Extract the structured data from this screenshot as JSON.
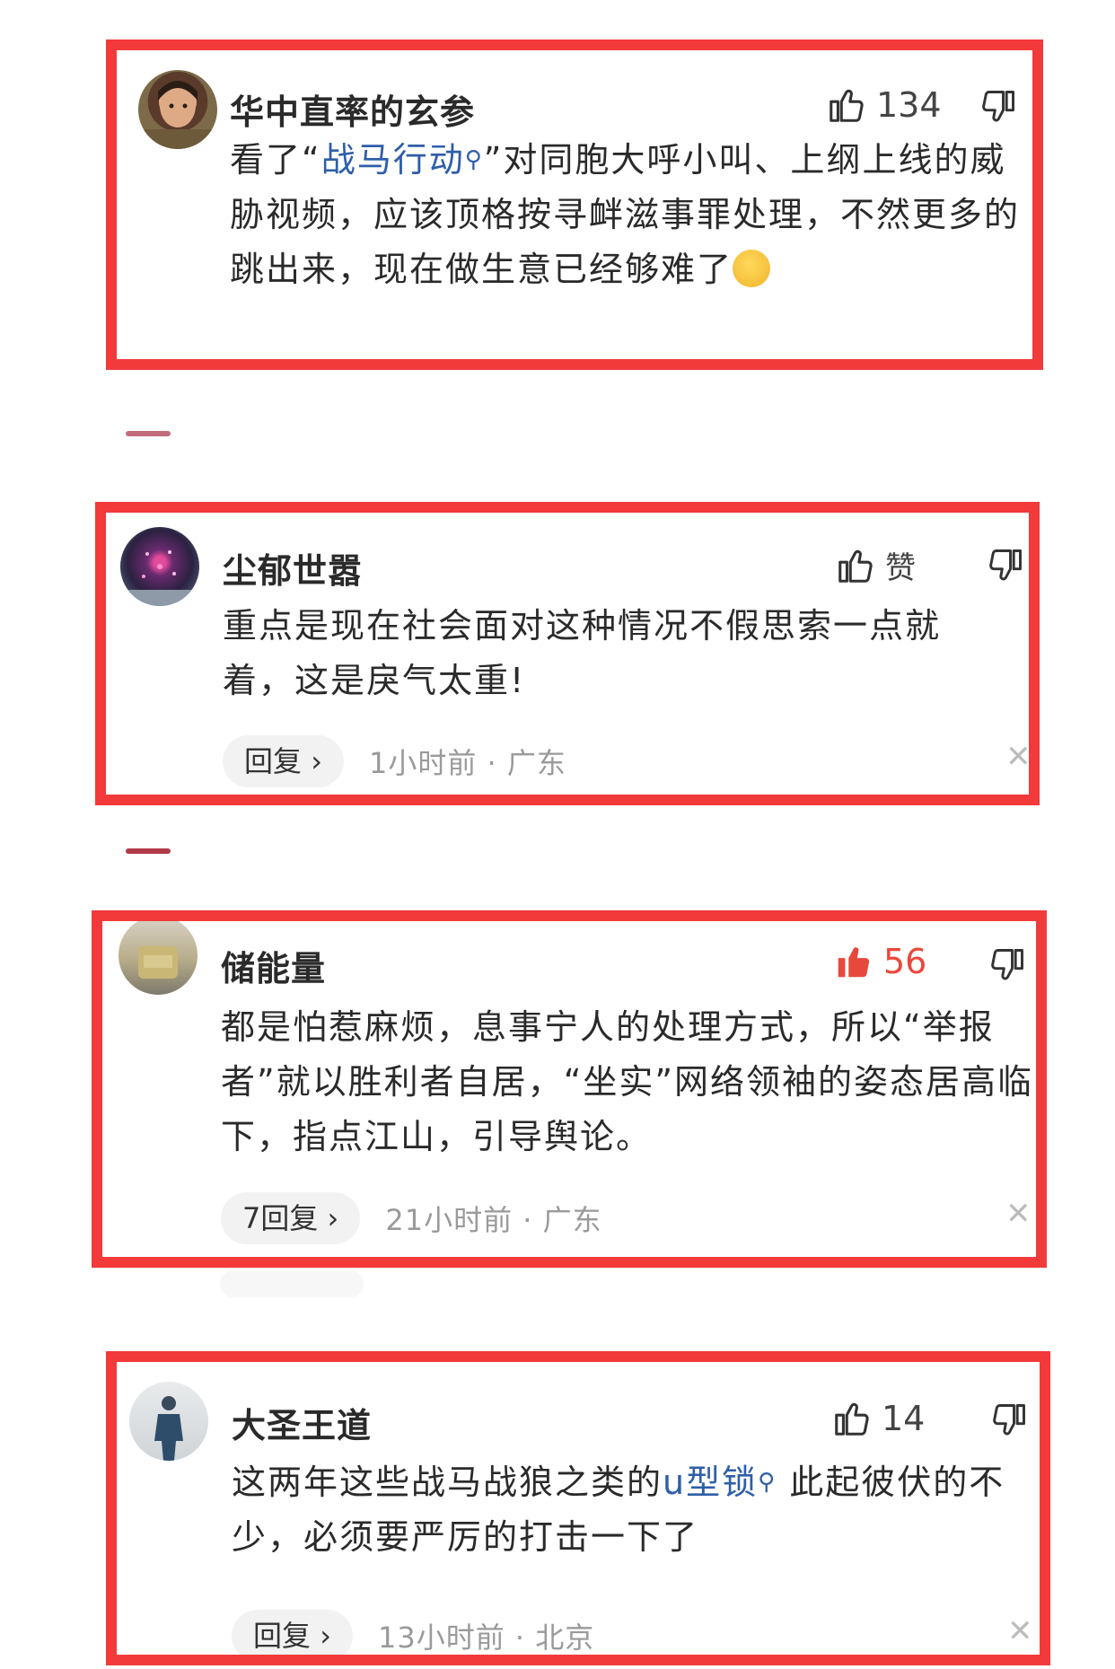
{
  "comments": [
    {
      "username": "华中直率的玄参",
      "like_count": "134",
      "text_before": "看了“",
      "topic": "战马行动",
      "text_after": "”对同胞大呼小叫、上纲上线的威胁视频，应该顶格按寻衅滋事罪处理，不然更多的跳出来，现在做生意已经够难了"
    },
    {
      "username": "尘郁世嚣",
      "like_label": "赞",
      "text": "重点是现在社会面对这种情况不假思索一点就着，这是戾气太重!",
      "reply_label": "回复",
      "time": "1小时前 · 广东"
    },
    {
      "username": "储能量",
      "like_count": "56",
      "text": "都是怕惹麻烦，息事宁人的处理方式，所以“举报者”就以胜利者自居，“坐实”网络领袖的姿态居高临下，指点江山，引导舆论。",
      "reply_label": "7回复",
      "time": "21小时前 · 广东"
    },
    {
      "username": "大圣王道",
      "like_count": "14",
      "text_before": "这两年这些战马战狼之类的",
      "topic": "u型锁",
      "text_after": " 此起彼伏的不少，必须要严厉的打击一下了",
      "reply_label": "回复",
      "time": "13小时前 · 北京"
    }
  ],
  "icons": {
    "like": "thumbs-up-icon",
    "like_active": "thumbs-up-filled-icon",
    "dislike": "thumbs-down-icon",
    "close": "close-icon",
    "search": "search-icon",
    "chevron": "chevron-right-icon"
  },
  "colors": {
    "highlight_border": "#f23a3a",
    "like_active": "#e8483b",
    "topic_link": "#2e5ea8",
    "meta_text": "#9a9a9a"
  }
}
